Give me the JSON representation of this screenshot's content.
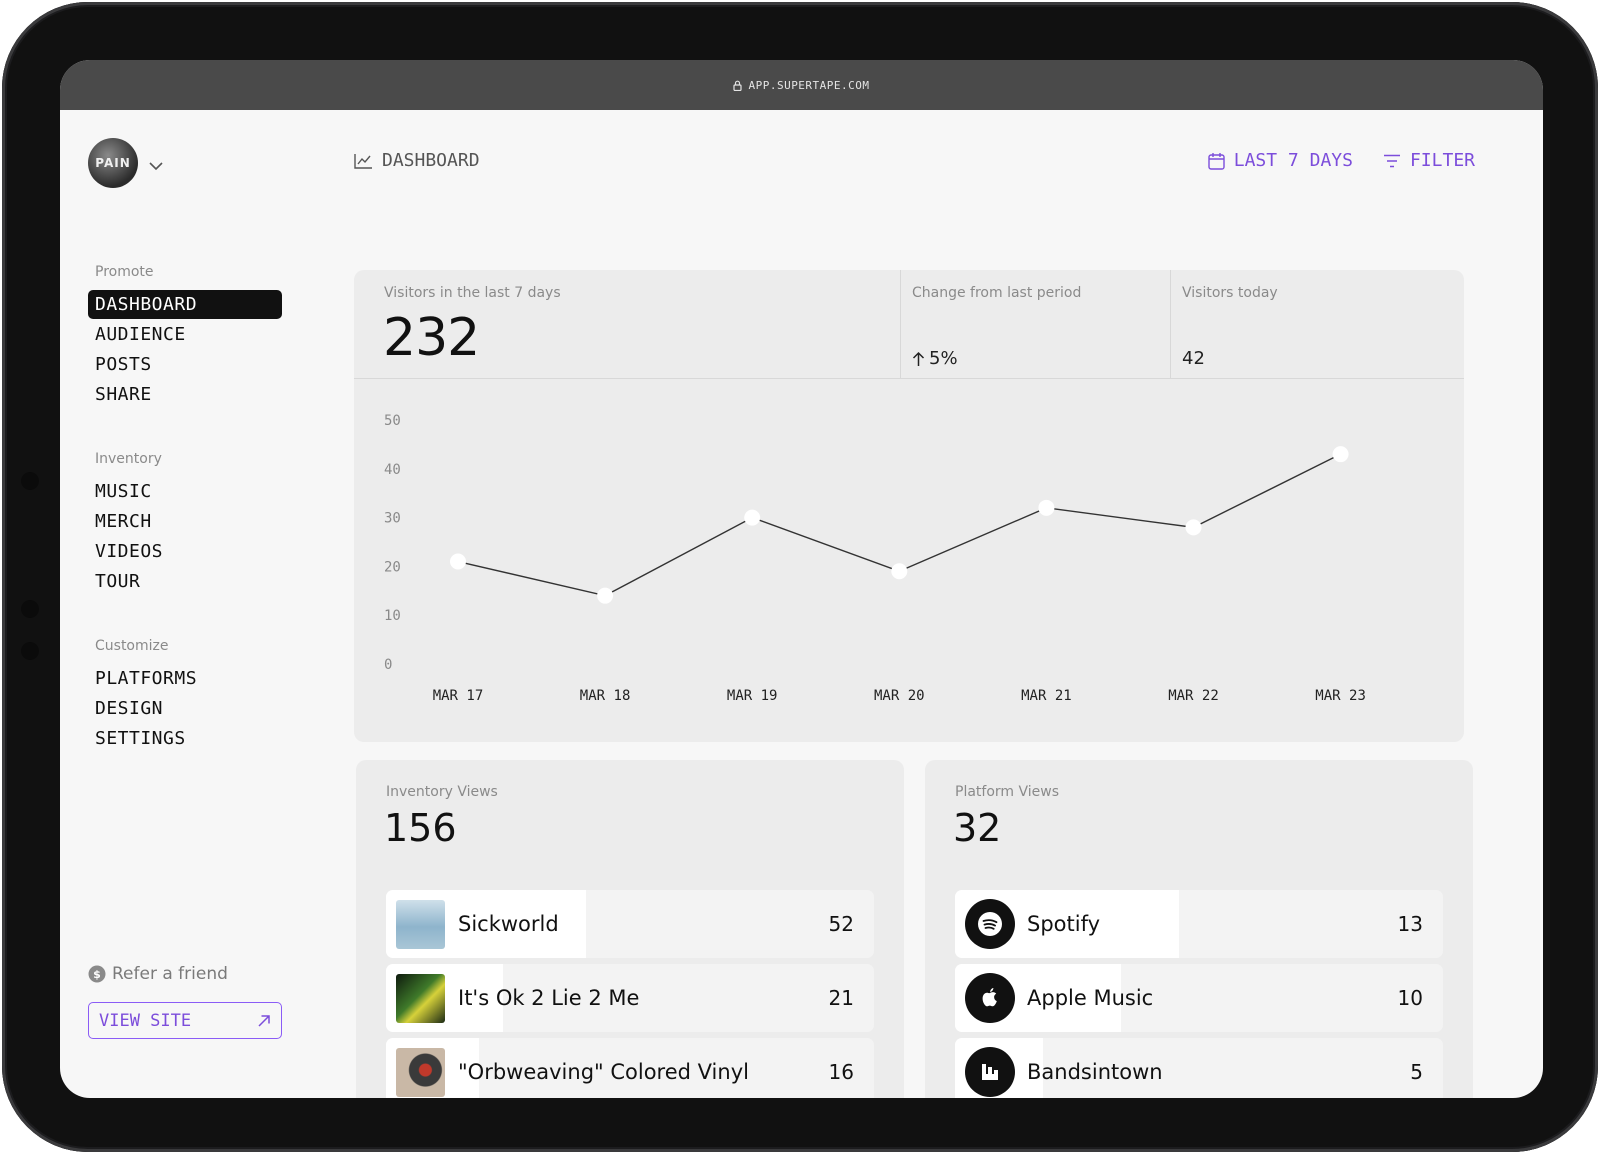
{
  "browser": {
    "url": "APP.SUPERTAPE.COM"
  },
  "profile": {
    "avatar_text": "PAIN"
  },
  "header": {
    "title": "DASHBOARD",
    "date_range": "LAST 7 DAYS",
    "filter": "FILTER"
  },
  "sidebar": {
    "sections": [
      {
        "title": "Promote",
        "items": [
          {
            "label": "DASHBOARD",
            "active": true
          },
          {
            "label": "AUDIENCE"
          },
          {
            "label": "POSTS"
          },
          {
            "label": "SHARE"
          }
        ]
      },
      {
        "title": "Inventory",
        "items": [
          {
            "label": "MUSIC"
          },
          {
            "label": "MERCH"
          },
          {
            "label": "VIDEOS"
          },
          {
            "label": "TOUR"
          }
        ]
      },
      {
        "title": "Customize",
        "items": [
          {
            "label": "PLATFORMS"
          },
          {
            "label": "DESIGN"
          },
          {
            "label": "SETTINGS"
          }
        ]
      }
    ],
    "refer": "Refer a friend",
    "view_site": "VIEW SITE"
  },
  "stats": {
    "visitors_label": "Visitors in the last 7 days",
    "visitors_value": "232",
    "change_label": "Change from last period",
    "change_value": "5%",
    "today_label": "Visitors today",
    "today_value": "42"
  },
  "chart_data": {
    "type": "line",
    "categories": [
      "MAR 17",
      "MAR 18",
      "MAR 19",
      "MAR 20",
      "MAR 21",
      "MAR 22",
      "MAR 23"
    ],
    "series": [
      {
        "values": [
          21,
          14,
          30,
          19,
          32,
          28,
          43
        ]
      }
    ],
    "yticks": [
      0,
      10,
      20,
      30,
      40,
      50
    ],
    "ylim": [
      0,
      50
    ],
    "grid": false,
    "line_color": "#333333",
    "marker_color": "#ffffff"
  },
  "inventory": {
    "label": "Inventory Views",
    "total": "156",
    "items": [
      {
        "name": "Sickworld",
        "count": "52",
        "fraction": 0.41
      },
      {
        "name": "It's Ok 2 Lie 2 Me",
        "count": "21",
        "fraction": 0.24
      },
      {
        "name": "\"Orbweaving\" Colored Vinyl",
        "count": "16",
        "fraction": 0.19
      }
    ]
  },
  "platforms": {
    "label": "Platform Views",
    "total": "32",
    "items": [
      {
        "name": "Spotify",
        "count": "13",
        "fraction": 0.46,
        "icon": "spotify-icon"
      },
      {
        "name": "Apple Music",
        "count": "10",
        "fraction": 0.34,
        "icon": "apple-icon"
      },
      {
        "name": "Bandsintown",
        "count": "5",
        "fraction": 0.18,
        "icon": "bandsintown-icon"
      }
    ]
  },
  "colors": {
    "accent": "#7c4ddb",
    "frame": "#111111",
    "card": "#ececec"
  }
}
